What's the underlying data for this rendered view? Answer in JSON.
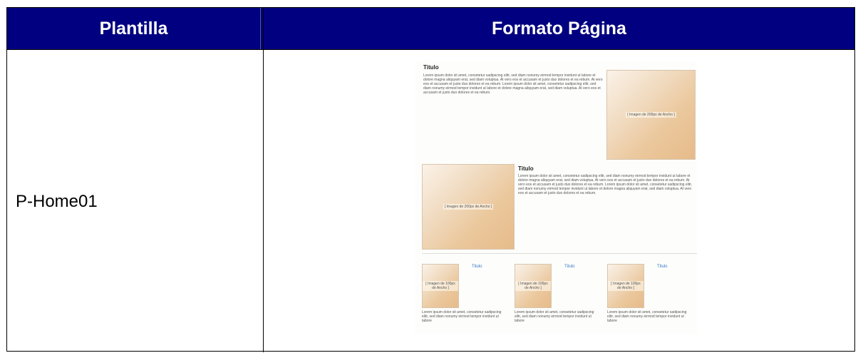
{
  "table": {
    "headers": [
      "Plantilla",
      "Formato Página"
    ],
    "rows": [
      {
        "template": "P-Home01"
      }
    ]
  },
  "preview": {
    "block1": {
      "title": "Titulo",
      "body": "Lorem ipsum dolor sit amet, consetetur sadipscing elitr, sed diam nonumy eirmod tempor invidunt ut labore et dolore magna aliquyam erat, sed diam voluptua. At vero eos et accusam et justo duo dolores et ea rebum. At vero eos et accusam et justo duo dolores et ea rebum. Lorem ipsum dolor sit amet, consetetur sadipscing elitr, sed diam nonumy eirmod tempor invidunt ut labore et dolore magna aliquyam erat, sed diam voluptua. At vero eos et accusam et justo duo dolores et ea rebum.",
      "image_caption": "[ Imagen de 200px de Ancho ]"
    },
    "block2": {
      "title": "Titulo",
      "body": "Lorem ipsum dolor sit amet, consetetur sadipscing elitr, sed diam nonumy eirmod tempor invidunt ut labore et dolore magna aliquyam erat, sed diam voluptua. At vero eos et accusam et justo duo dolores et ea rebum. At vero eos et accusam et justo duo dolores et ea rebum. Lorem ipsum dolor sit amet, consetetur sadipscing elitr, sed diam nonumy eirmod tempor invidunt ut labore et dolore magna aliquyam erat, sed diam voluptua. At vero eos et accusam et justo duo dolores et ea rebum.",
      "image_caption": "[ Imagen de 200px de Ancho ]"
    },
    "small_items": [
      {
        "title": "Titulo",
        "image_caption": "[ Imagen de 100px de Ancho ]",
        "body": "Lorem ipsum dolor sit amet, consetetur sadipscing elitr, sed diam nonumy eirmod tempor invidunt ut labore"
      },
      {
        "title": "Titulo",
        "image_caption": "[ Imagen de 100px de Ancho ]",
        "body": "Lorem ipsum dolor sit amet, consetetur sadipscing elitr, sed diam nonumy eirmod tempor invidunt ut labore"
      },
      {
        "title": "Titulo",
        "image_caption": "[ Imagen de 100px de Ancho ]",
        "body": "Lorem ipsum dolor sit amet, consetetur sadipscing elitr, sed diam nonumy eirmod tempor invidunt ut labore"
      }
    ]
  }
}
